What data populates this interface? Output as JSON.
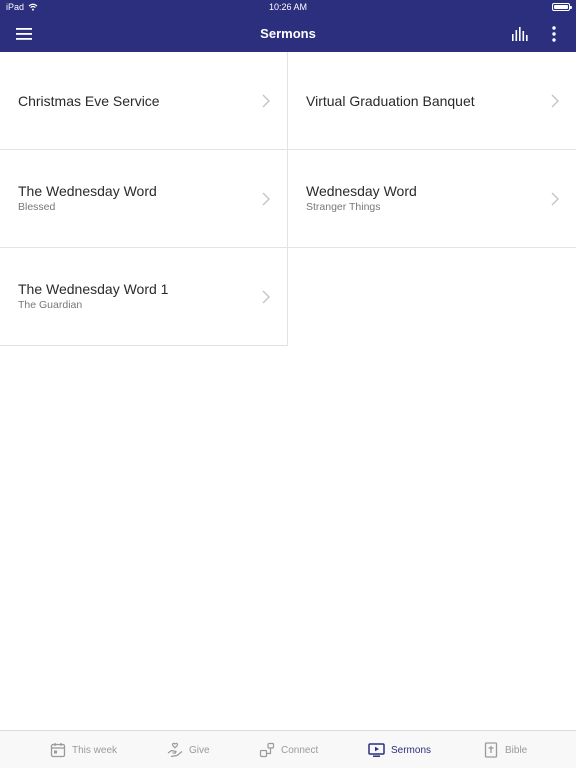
{
  "status_bar": {
    "device": "iPad",
    "time": "10:26 AM"
  },
  "header": {
    "title": "Sermons",
    "icons": [
      "menu-icon",
      "audio-bars-icon",
      "more-vertical-icon"
    ],
    "background_color": "#2b2f7e"
  },
  "sermons": [
    {
      "title": "Christmas Eve Service",
      "subtitle": ""
    },
    {
      "title": "Virtual Graduation Banquet",
      "subtitle": ""
    },
    {
      "title": "The Wednesday Word",
      "subtitle": "Blessed"
    },
    {
      "title": "Wednesday Word",
      "subtitle": "Stranger Things"
    },
    {
      "title": "The Wednesday Word 1",
      "subtitle": "The Guardian"
    }
  ],
  "tab_bar": {
    "tabs": [
      {
        "label": "This week",
        "icon": "calendar-icon",
        "active": false
      },
      {
        "label": "Give",
        "icon": "giving-hand-icon",
        "active": false
      },
      {
        "label": "Connect",
        "icon": "connect-icon",
        "active": false
      },
      {
        "label": "Sermons",
        "icon": "play-screen-icon",
        "active": true
      },
      {
        "label": "Bible",
        "icon": "bible-icon",
        "active": false
      }
    ],
    "active_color": "#2b2f7e",
    "inactive_color": "#9a9a9a"
  }
}
